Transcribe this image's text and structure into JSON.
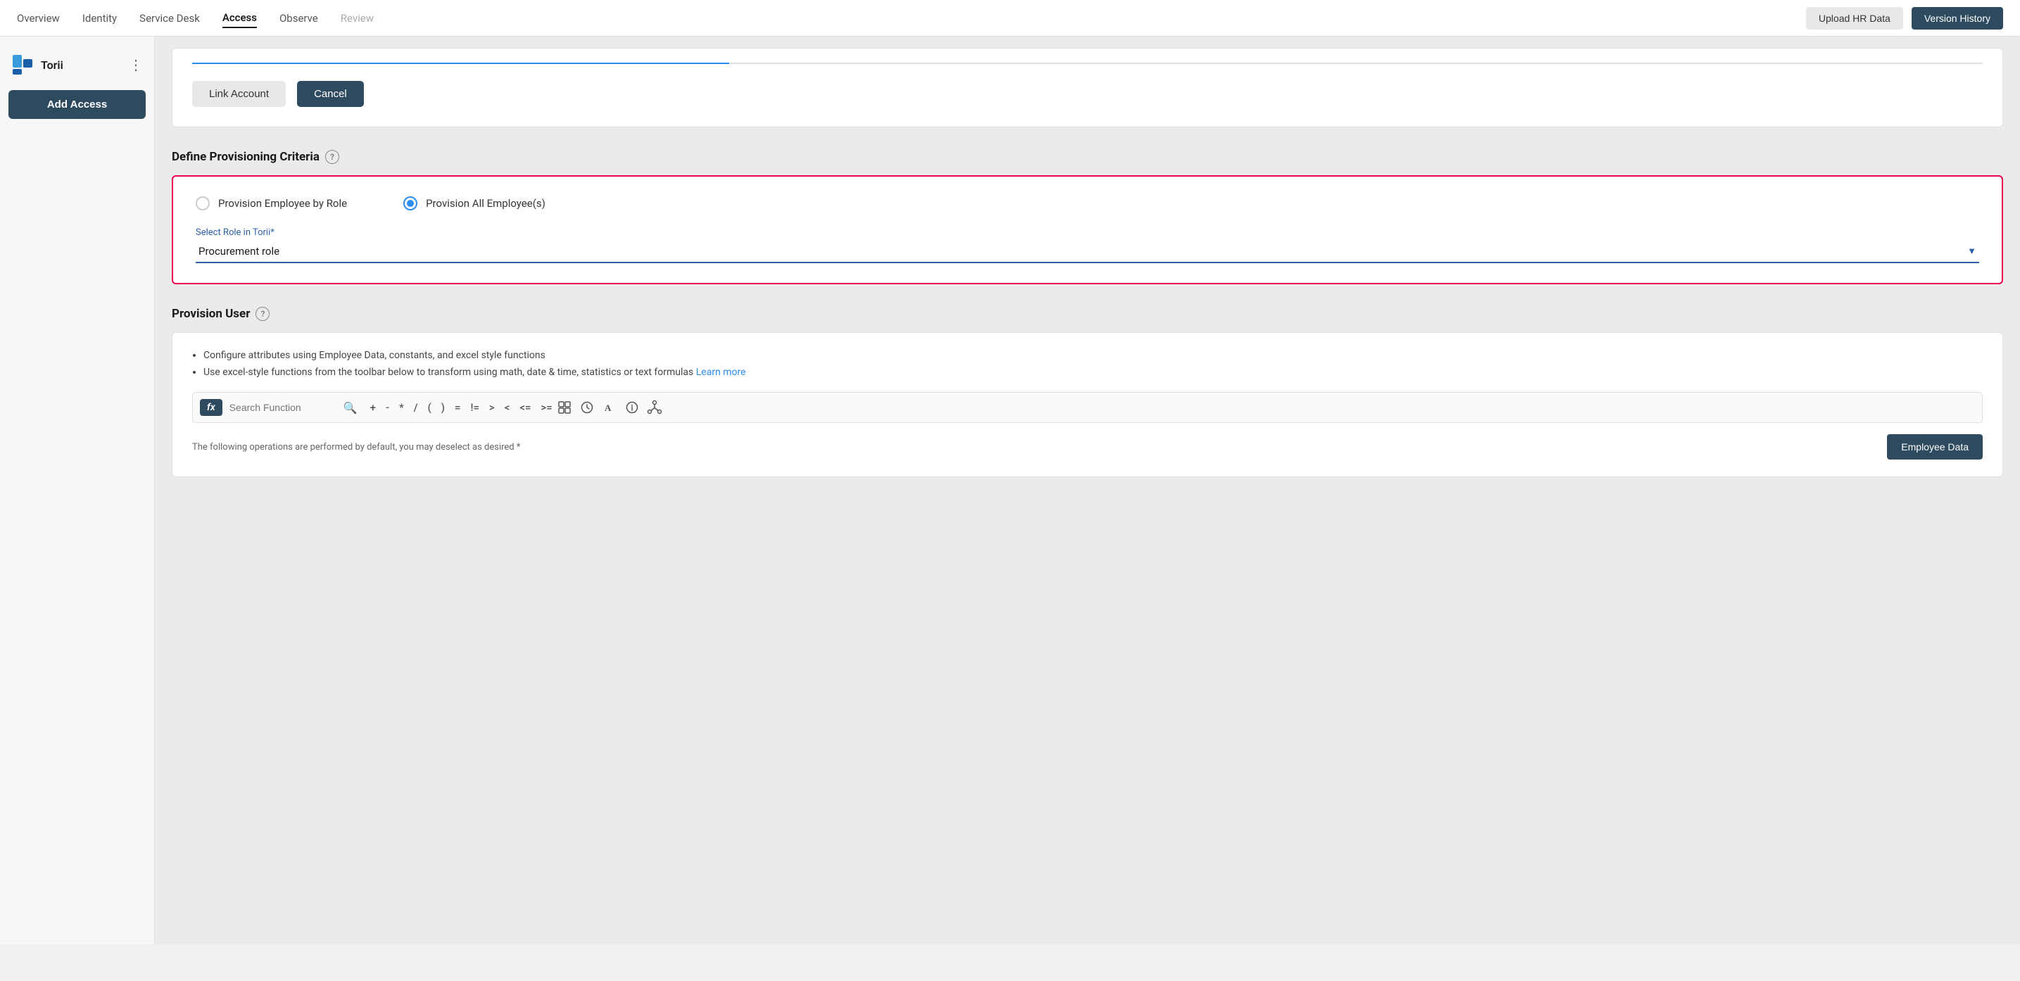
{
  "nav": {
    "links": [
      {
        "label": "Overview",
        "active": false,
        "disabled": false
      },
      {
        "label": "Identity",
        "active": false,
        "disabled": false
      },
      {
        "label": "Service Desk",
        "active": false,
        "disabled": false
      },
      {
        "label": "Access",
        "active": true,
        "disabled": false
      },
      {
        "label": "Observe",
        "active": false,
        "disabled": false
      },
      {
        "label": "Review",
        "active": false,
        "disabled": true
      }
    ],
    "upload_hr_data": "Upload HR Data",
    "version_history": "Version History"
  },
  "sidebar": {
    "app_name": "Torii",
    "add_access_label": "Add Access"
  },
  "link_section": {
    "link_account_label": "Link Account",
    "cancel_label": "Cancel"
  },
  "define_provisioning": {
    "title": "Define Provisioning Criteria",
    "option1": "Provision Employee by Role",
    "option2": "Provision All Employee(s)",
    "role_label": "Select Role in Torii*",
    "role_value": "Procurement role"
  },
  "provision_user": {
    "title": "Provision User",
    "bullet1": "Configure attributes using Employee Data, constants, and excel style functions",
    "bullet2": "Use excel-style functions from the toolbar below to transform using math, date & time, statistics or text formulas",
    "learn_more": "Learn more",
    "fx_label": "fx",
    "search_placeholder": "Search Function",
    "ops": [
      "+",
      "-",
      "*",
      "/",
      "(",
      ")",
      "=",
      "!=",
      ">",
      "<",
      "<=",
      ">="
    ],
    "bottom_text": "The following operations are performed by default, you may deselect as desired *",
    "employee_data_label": "Employee Data"
  }
}
